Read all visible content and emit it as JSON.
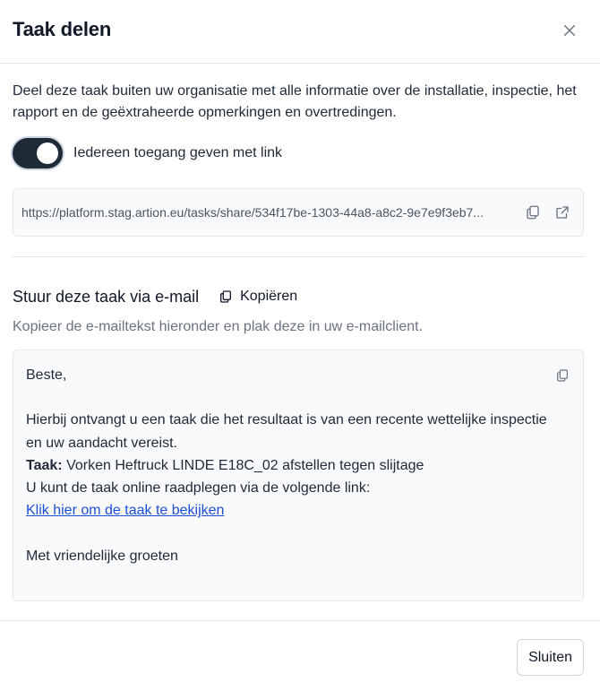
{
  "dialog": {
    "title": "Taak delen"
  },
  "description": "Deel deze taak buiten uw organisatie met alle informatie over de installatie, inspectie, het rapport en de geëxtraheerde opmerkingen en overtredingen.",
  "share_toggle": {
    "label": "Iedereen toegang geven met link",
    "enabled": true
  },
  "share_link": {
    "url": "https://platform.stag.artion.eu/tasks/share/534f17be-1303-44a8-a8c2-9e7e9f3eb7..."
  },
  "email": {
    "title": "Stuur deze taak via e-mail",
    "copy_label": "Kopiëren",
    "hint": "Kopieer de e-mailtekst hieronder en plak deze in uw e-mailclient.",
    "greeting": "Beste,",
    "body_line1": "Hierbij ontvangt u een taak die het resultaat is van een recente wettelijke inspectie",
    "body_line2": "en uw aandacht vereist.",
    "task_label": "Taak:",
    "task_value": "Vorken Heftruck LINDE E18C_02 afstellen tegen slijtage",
    "online_text": "U kunt de taak online raadplegen via de volgende link:",
    "link_text": "Klik hier om de taak te bekijken",
    "closing": "Met vriendelijke groeten"
  },
  "footer": {
    "close_label": "Sluiten"
  },
  "icons": {
    "close": "close-icon",
    "copy": "copy-icon",
    "external": "external-link-icon"
  },
  "colors": {
    "toggle_on": "#1f2a37",
    "link": "#1d4ed8",
    "border": "#e5e7eb"
  }
}
